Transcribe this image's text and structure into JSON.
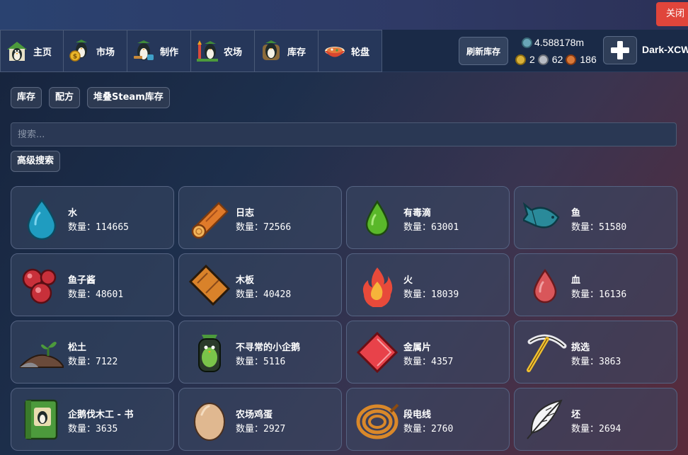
{
  "window": {
    "close_label": "关闭"
  },
  "nav": {
    "tabs": [
      {
        "label": "主页",
        "icon": "penguin-home-icon"
      },
      {
        "label": "市场",
        "icon": "penguin-coin-icon"
      },
      {
        "label": "制作",
        "icon": "penguin-tools-icon"
      },
      {
        "label": "农场",
        "icon": "penguin-farm-icon"
      },
      {
        "label": "库存",
        "icon": "penguin-backpack-icon"
      },
      {
        "label": "轮盘",
        "icon": "roulette-bowl-icon"
      }
    ],
    "refresh_label": "刷新库存",
    "balance": "4.588178m",
    "stats": {
      "gold": "2",
      "silver": "62",
      "bronze": "186"
    },
    "username": "Dark-XCW"
  },
  "subtabs": {
    "inventory": "库存",
    "recipes": "配方",
    "steam": "堆叠Steam库存"
  },
  "search": {
    "placeholder": "搜索..."
  },
  "advanced_search_label": "高级搜索",
  "qty_prefix": "数量：",
  "items": [
    {
      "name": "水",
      "qty": "114665",
      "icon": "water-drop-icon"
    },
    {
      "name": "日志",
      "qty": "72566",
      "icon": "log-icon"
    },
    {
      "name": "有毒滴",
      "qty": "63001",
      "icon": "poison-drop-icon"
    },
    {
      "name": "鱼",
      "qty": "51580",
      "icon": "fish-icon"
    },
    {
      "name": "鱼子酱",
      "qty": "48601",
      "icon": "caviar-icon"
    },
    {
      "name": "木板",
      "qty": "40428",
      "icon": "plank-icon"
    },
    {
      "name": "火",
      "qty": "18039",
      "icon": "fire-icon"
    },
    {
      "name": "血",
      "qty": "16136",
      "icon": "blood-drop-icon"
    },
    {
      "name": "松土",
      "qty": "7122",
      "icon": "soil-sprout-icon"
    },
    {
      "name": "不寻常的小企鹅",
      "qty": "5116",
      "icon": "penguin-jar-icon"
    },
    {
      "name": "金属片",
      "qty": "4357",
      "icon": "metal-sheet-icon"
    },
    {
      "name": "挑选",
      "qty": "3863",
      "icon": "pickaxe-icon"
    },
    {
      "name": "企鹅伐木工 - 书",
      "qty": "3635",
      "icon": "book-icon"
    },
    {
      "name": "农场鸡蛋",
      "qty": "2927",
      "icon": "egg-icon"
    },
    {
      "name": "段电线",
      "qty": "2760",
      "icon": "wire-coil-icon"
    },
    {
      "name": "坯",
      "qty": "2694",
      "icon": "feather-icon"
    }
  ],
  "colors": {
    "close_button": "#e0453b",
    "card_border": "#556382",
    "top_bar": "#2f3e6a"
  }
}
